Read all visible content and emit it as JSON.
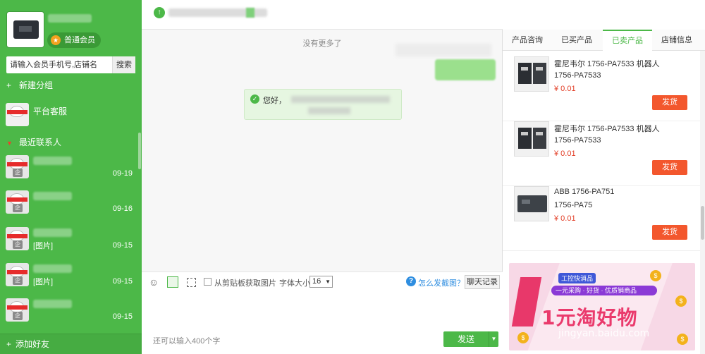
{
  "sidebar": {
    "member_badge": "普通会员",
    "member_medal_glyph": "★",
    "search": {
      "placeholder": "请输入会员手机号,店铺名",
      "button": "搜索"
    },
    "new_group": "新建分组",
    "new_group_glyph": "+",
    "service_contact": {
      "name": "平台客服"
    },
    "recent_header": "最近联系人",
    "recent_glyph": "▼",
    "avatar_tag": "企",
    "contacts": [
      {
        "sub": "",
        "date": "09-19"
      },
      {
        "sub": "",
        "date": "09-16"
      },
      {
        "sub": "[图片]",
        "date": "09-15"
      },
      {
        "sub": "[图片]",
        "date": "09-15"
      },
      {
        "sub": "",
        "date": "09-15"
      }
    ],
    "add_friend": "添加好友",
    "add_friend_glyph": "+"
  },
  "chat": {
    "up_glyph": "↑",
    "no_more": "没有更多了",
    "greeting": "您好，",
    "check_glyph": "✓",
    "toolbar": {
      "emoji_glyph": "☺",
      "clipboard_label": "从剪贴板获取图片",
      "font_size_label": "字体大小",
      "font_size_value": "16",
      "font_arrow": "▼",
      "help_glyph": "?",
      "help_link": "怎么发截图？",
      "history_button": "聊天记录"
    },
    "char_count": "还可以输入400个字",
    "send_button": "发送",
    "send_drop_glyph": "▼"
  },
  "right_panel": {
    "tabs": [
      {
        "label": "产品咨询",
        "active": false
      },
      {
        "label": "已买产品",
        "active": false
      },
      {
        "label": "已卖产品",
        "active": true
      },
      {
        "label": "店铺信息",
        "active": false
      }
    ],
    "products": [
      {
        "title": "霍尼韦尔 1756-PA7533 机器人",
        "model": "1756-PA7533",
        "price": "¥ 0.01",
        "button": "发货"
      },
      {
        "title": "霍尼韦尔 1756-PA7533 机器人",
        "model": "1756-PA7533",
        "price": "¥ 0.01",
        "button": "发货"
      },
      {
        "title": "ABB 1756-PA751",
        "model": "1756-PA75",
        "price": "¥ 0.01",
        "button": "发货"
      }
    ],
    "banner": {
      "tag": "工控快消品",
      "pill": "一元采购 · 好货 · 优质销商品",
      "headline": "1元淘好物",
      "watermark": "jingyan.baidu.com",
      "coin_glyph": "$"
    }
  },
  "colors": {
    "brand_green": "#4cb848",
    "ship_orange": "#f3572d",
    "price_red": "#e23c24",
    "link_blue": "#2f8ee0"
  }
}
